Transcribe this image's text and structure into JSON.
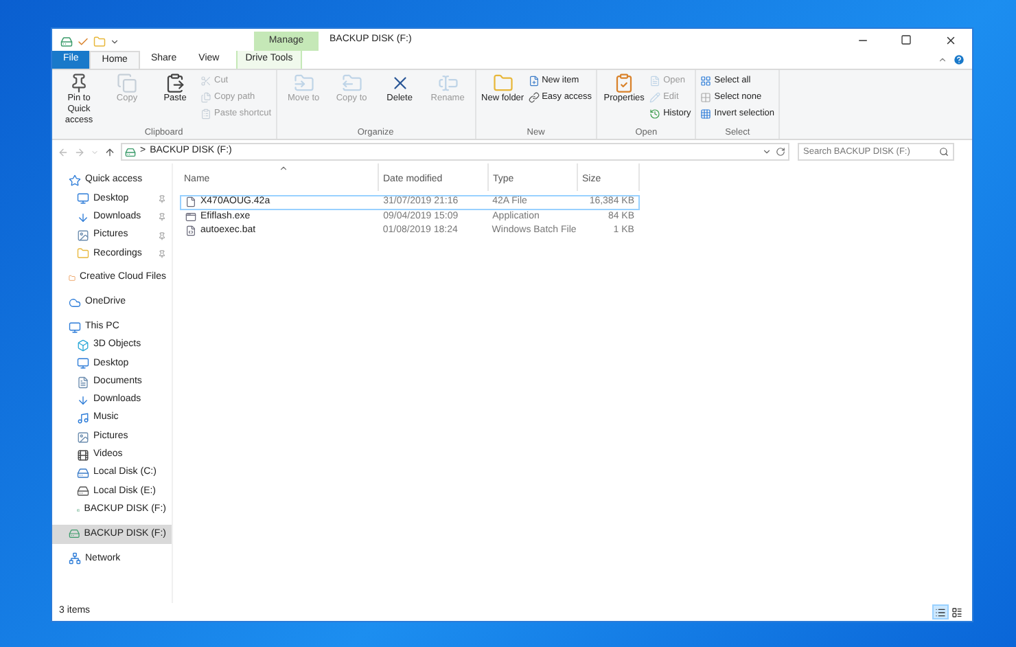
{
  "window": {
    "title": "BACKUP DISK (F:)",
    "context_tab": "Manage"
  },
  "tabs": [
    {
      "label": "File",
      "kind": "file",
      "selected": false
    },
    {
      "label": "Home",
      "kind": "tab",
      "selected": true
    },
    {
      "label": "Share",
      "kind": "tab",
      "selected": false
    },
    {
      "label": "View",
      "kind": "tab",
      "selected": false
    },
    {
      "label": "Drive Tools",
      "kind": "context",
      "selected": false
    }
  ],
  "ribbon": [
    {
      "label": "Clipboard",
      "items": [
        {
          "label": "Pin to Quick access",
          "kind": "large",
          "disabled": false
        },
        {
          "label": "Copy",
          "kind": "large",
          "disabled": true
        },
        {
          "label": "Paste",
          "kind": "large",
          "disabled": false
        },
        {
          "label": "Cut",
          "kind": "small",
          "disabled": true
        },
        {
          "label": "Copy path",
          "kind": "small",
          "disabled": true
        },
        {
          "label": "Paste shortcut",
          "kind": "small",
          "disabled": true
        }
      ]
    },
    {
      "label": "Organize",
      "items": [
        {
          "label": "Move to",
          "kind": "large",
          "disabled": true
        },
        {
          "label": "Copy to",
          "kind": "large",
          "disabled": true
        },
        {
          "label": "Delete",
          "kind": "large",
          "disabled": false
        },
        {
          "label": "Rename",
          "kind": "large",
          "disabled": true
        }
      ]
    },
    {
      "label": "New",
      "items": [
        {
          "label": "New folder",
          "kind": "large",
          "disabled": false
        },
        {
          "label": "New item",
          "kind": "small",
          "disabled": false
        },
        {
          "label": "Easy access",
          "kind": "small",
          "disabled": false
        }
      ]
    },
    {
      "label": "Open",
      "items": [
        {
          "label": "Properties",
          "kind": "large",
          "disabled": false
        },
        {
          "label": "Open",
          "kind": "small",
          "disabled": true
        },
        {
          "label": "Edit",
          "kind": "small",
          "disabled": true
        },
        {
          "label": "History",
          "kind": "small",
          "disabled": false
        }
      ]
    },
    {
      "label": "Select",
      "items": [
        {
          "label": "Select all",
          "kind": "small",
          "disabled": false
        },
        {
          "label": "Select none",
          "kind": "small",
          "disabled": false
        },
        {
          "label": "Invert selection",
          "kind": "small",
          "disabled": false
        }
      ]
    }
  ],
  "address": {
    "separator": ">",
    "path": "BACKUP DISK (F:)"
  },
  "search": {
    "placeholder": "Search BACKUP DISK (F:)"
  },
  "sidebar": {
    "items": [
      {
        "label": "Quick access",
        "selected": false,
        "children": [
          {
            "label": "Desktop",
            "pinned": true,
            "selected": false
          },
          {
            "label": "Downloads",
            "pinned": true,
            "selected": false
          },
          {
            "label": "Pictures",
            "pinned": true,
            "selected": false
          },
          {
            "label": "Recordings",
            "pinned": true,
            "selected": false
          }
        ]
      },
      {
        "label": "Creative Cloud Files",
        "selected": false
      },
      {
        "label": "OneDrive",
        "selected": false
      },
      {
        "label": "This PC",
        "selected": false,
        "children": [
          {
            "label": "3D Objects",
            "selected": false
          },
          {
            "label": "Desktop",
            "selected": false
          },
          {
            "label": "Documents",
            "selected": false
          },
          {
            "label": "Downloads",
            "selected": false
          },
          {
            "label": "Music",
            "selected": false
          },
          {
            "label": "Pictures",
            "selected": false
          },
          {
            "label": "Videos",
            "selected": false
          },
          {
            "label": "Local Disk (C:)",
            "selected": false
          },
          {
            "label": "Local Disk (E:)",
            "selected": false
          },
          {
            "label": "BACKUP DISK (F:)",
            "selected": false
          }
        ]
      },
      {
        "label": "BACKUP DISK (F:)",
        "selected": true
      },
      {
        "label": "Network",
        "selected": false
      }
    ]
  },
  "table": {
    "columns": [
      {
        "label": "Name",
        "sorted": true
      },
      {
        "label": "Date modified",
        "sorted": false
      },
      {
        "label": "Type",
        "sorted": false
      },
      {
        "label": "Size",
        "sorted": false
      }
    ],
    "rows": [
      {
        "name": "X470AOUG.42a",
        "date": "31/07/2019 21:16",
        "type": "42A File",
        "size": "16,384 KB",
        "selected": true
      },
      {
        "name": "Efiflash.exe",
        "date": "09/04/2019 15:09",
        "type": "Application",
        "size": "84 KB",
        "selected": false
      },
      {
        "name": "autoexec.bat",
        "date": "01/08/2019 18:24",
        "type": "Windows Batch File",
        "size": "1 KB",
        "selected": false
      }
    ]
  },
  "status_bar": {
    "text": "3 items",
    "views": [
      {
        "selected": true
      },
      {
        "selected": false
      }
    ]
  }
}
